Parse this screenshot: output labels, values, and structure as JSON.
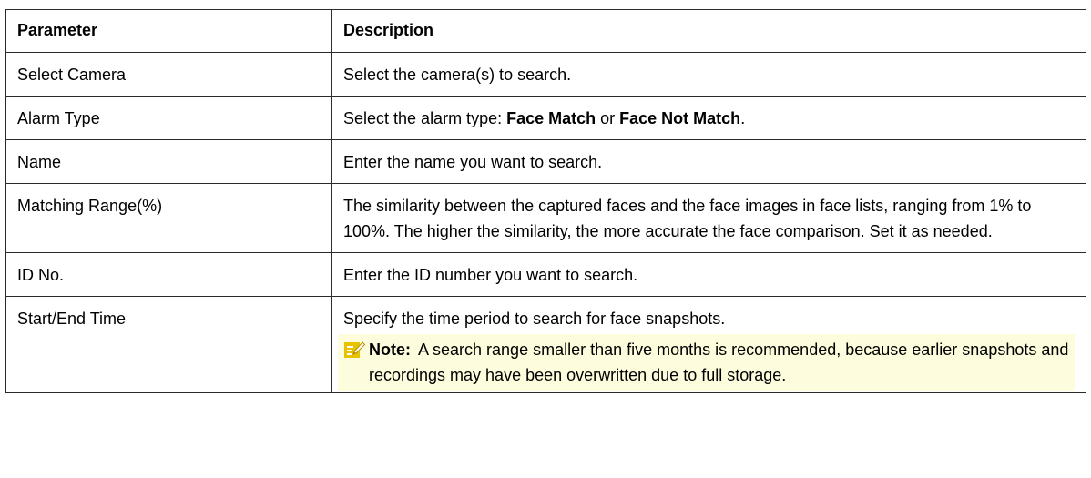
{
  "table": {
    "headers": {
      "parameter": "Parameter",
      "description": "Description"
    },
    "rows": [
      {
        "parameter": "Select Camera",
        "description": "Select the camera(s) to search."
      },
      {
        "parameter": "Alarm Type",
        "description_prefix": "Select the alarm type: ",
        "option_1": "Face Match",
        "description_middle": " or ",
        "option_2": "Face Not Match",
        "description_suffix": "."
      },
      {
        "parameter": "Name",
        "description": "Enter the name you want to search."
      },
      {
        "parameter": "Matching Range(%)",
        "description": "The similarity between the captured faces and the face images in face lists, ranging from 1% to 100%. The higher the similarity, the more accurate the face comparison. Set it as needed."
      },
      {
        "parameter": "ID No.",
        "description": "Enter the ID number you want to search."
      },
      {
        "parameter": "Start/End Time",
        "description": "Specify the time period to search for face snapshots.",
        "note": {
          "icon": "note-pencil-icon",
          "label": "Note:",
          "text": "A search range smaller than five months is recommended, because earlier snapshots and recordings may have been overwritten due to full storage."
        }
      }
    ]
  },
  "colors": {
    "border": "#2b2b2b",
    "note_background": "#fdfcdc",
    "note_icon": "#e6c200"
  }
}
